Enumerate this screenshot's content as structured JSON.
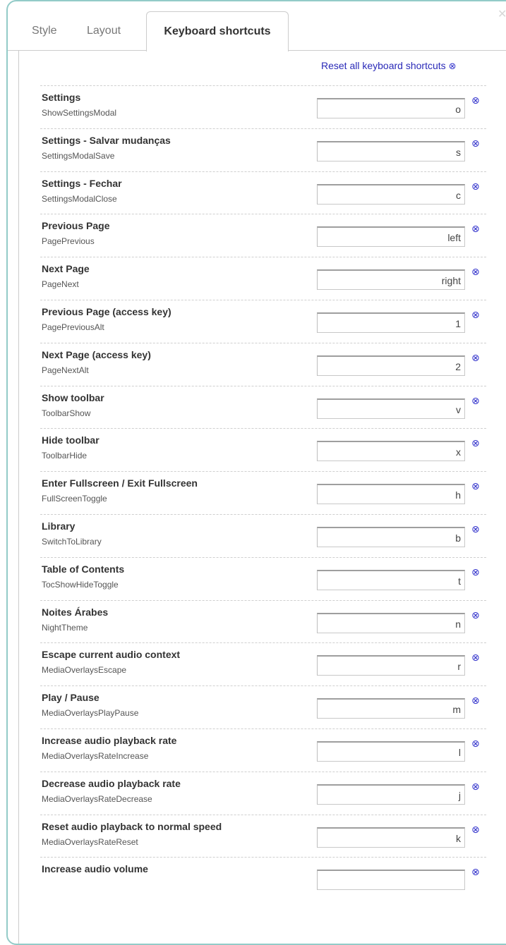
{
  "tabs": [
    {
      "label": "Style"
    },
    {
      "label": "Layout"
    },
    {
      "label": "Keyboard shortcuts",
      "active": true
    }
  ],
  "close_icon": "close-icon",
  "reset_all_label": "Reset all keyboard shortcuts",
  "reset_icon": "⊗",
  "shortcuts": [
    {
      "label": "Settings",
      "command": "ShowSettingsModal",
      "key": "o"
    },
    {
      "label": "Settings - Salvar mudanças",
      "command": "SettingsModalSave",
      "key": "s"
    },
    {
      "label": "Settings - Fechar",
      "command": "SettingsModalClose",
      "key": "c"
    },
    {
      "label": "Previous Page",
      "command": "PagePrevious",
      "key": "left"
    },
    {
      "label": "Next Page",
      "command": "PageNext",
      "key": "right"
    },
    {
      "label": "Previous Page (access key)",
      "command": "PagePreviousAlt",
      "key": "1"
    },
    {
      "label": "Next Page (access key)",
      "command": "PageNextAlt",
      "key": "2"
    },
    {
      "label": "Show toolbar",
      "command": "ToolbarShow",
      "key": "v"
    },
    {
      "label": "Hide toolbar",
      "command": "ToolbarHide",
      "key": "x"
    },
    {
      "label": "Enter Fullscreen / Exit Fullscreen",
      "command": "FullScreenToggle",
      "key": "h"
    },
    {
      "label": "Library",
      "command": "SwitchToLibrary",
      "key": "b"
    },
    {
      "label": "Table of Contents",
      "command": "TocShowHideToggle",
      "key": "t"
    },
    {
      "label": "Noites Árabes",
      "command": "NightTheme",
      "key": "n"
    },
    {
      "label": "Escape current audio context",
      "command": "MediaOverlaysEscape",
      "key": "r"
    },
    {
      "label": "Play / Pause",
      "command": "MediaOverlaysPlayPause",
      "key": "m"
    },
    {
      "label": "Increase audio playback rate",
      "command": "MediaOverlaysRateIncrease",
      "key": "l"
    },
    {
      "label": "Decrease audio playback rate",
      "command": "MediaOverlaysRateDecrease",
      "key": "j"
    },
    {
      "label": "Reset audio playback to normal speed",
      "command": "MediaOverlaysRateReset",
      "key": "k"
    },
    {
      "label": "Increase audio volume",
      "command": "",
      "key": ""
    }
  ]
}
